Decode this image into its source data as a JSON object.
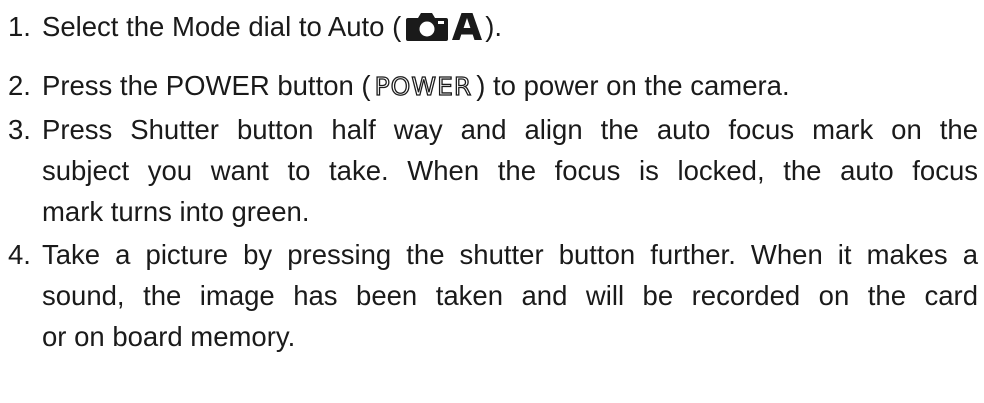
{
  "steps": [
    {
      "number": "1.",
      "before": "Select the Mode dial to Auto (",
      "after": ").",
      "icons": [
        "camera-icon",
        "auto-a-icon"
      ]
    },
    {
      "number": "2.",
      "before": "Press the POWER button (",
      "power_label": "POWER",
      "after": ")  to power on the camera."
    },
    {
      "number": "3.",
      "lines": [
        "Press Shutter button half way and align the auto focus mark on the",
        "subject you want to take. When the focus is locked, the auto focus",
        "mark turns into green."
      ]
    },
    {
      "number": "4.",
      "lines": [
        "Take a picture by pressing the shutter button further. When it makes a",
        "sound, the image has been taken and will be recorded on the card",
        "or on board memory."
      ]
    }
  ]
}
